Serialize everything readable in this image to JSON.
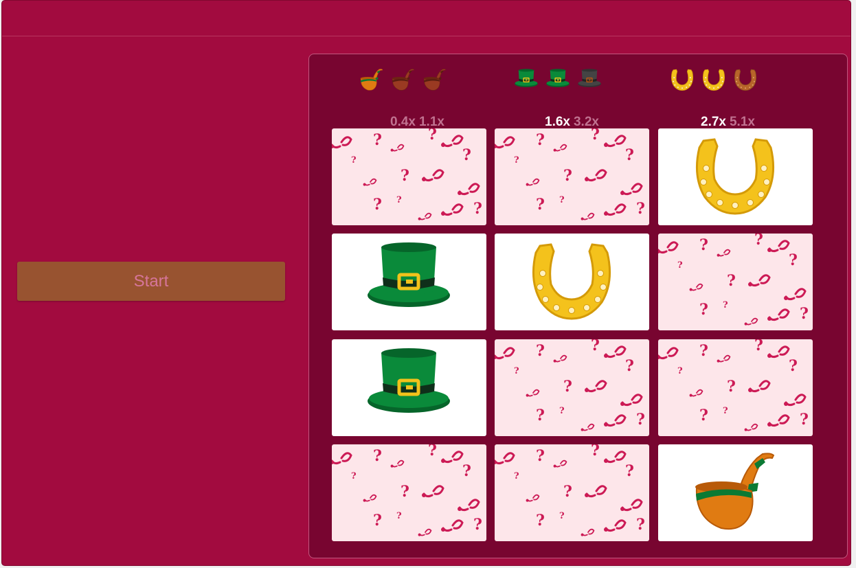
{
  "actions": {
    "start_label": "Start"
  },
  "paytable": [
    {
      "symbol": "pipe",
      "icon": "pipe-icon",
      "multipliers": [
        {
          "label": "0.4x",
          "active": false
        },
        {
          "label": "1.1x",
          "active": false
        }
      ]
    },
    {
      "symbol": "hat",
      "icon": "leprechaun-hat-icon",
      "multipliers": [
        {
          "label": "1.6x",
          "active": true
        },
        {
          "label": "3.2x",
          "active": false
        }
      ]
    },
    {
      "symbol": "horseshoe",
      "icon": "horseshoe-icon",
      "multipliers": [
        {
          "label": "2.7x",
          "active": true
        },
        {
          "label": "5.1x",
          "active": false
        }
      ]
    }
  ],
  "progress": {
    "pipe": 1,
    "hat": 2,
    "horseshoe": 2
  },
  "grid": {
    "rows": 4,
    "cols": 3,
    "tiles": [
      "hidden",
      "hidden",
      "horseshoe",
      "hat",
      "horseshoe",
      "hidden",
      "hat",
      "hidden",
      "hidden",
      "hidden",
      "hidden",
      "pipe"
    ]
  },
  "colors": {
    "background": "#a20b3f",
    "board": "#780530",
    "start_button": "#985330",
    "hidden_tile": "#fde6ea",
    "pattern": "#cc1a55"
  }
}
